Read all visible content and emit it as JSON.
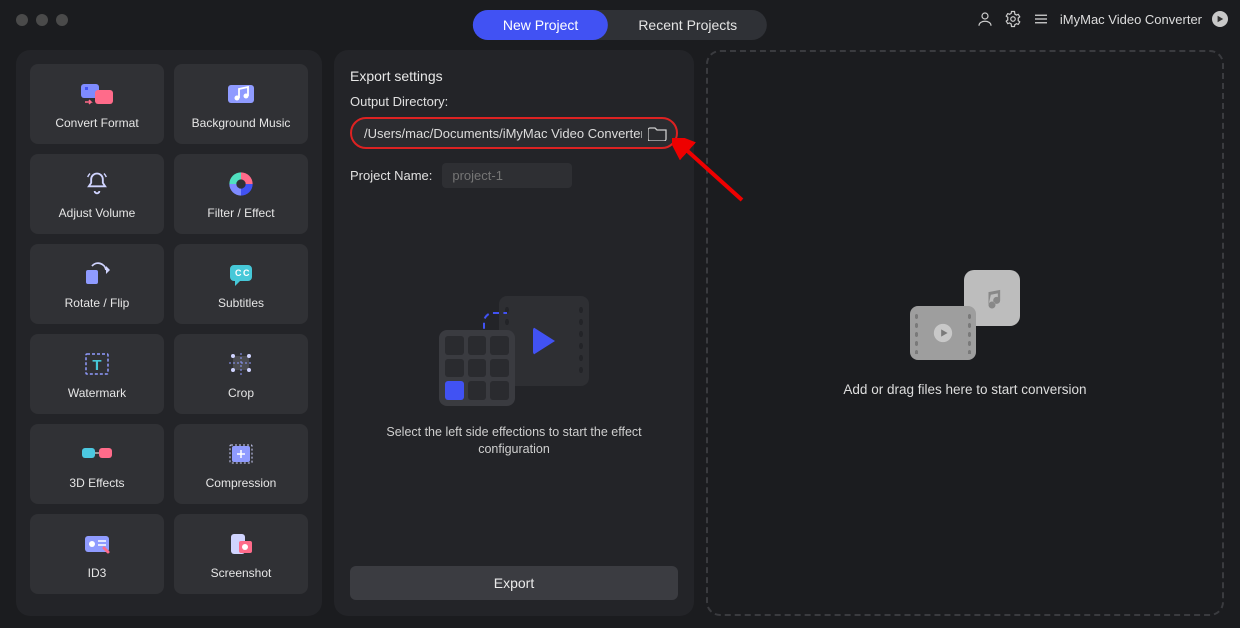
{
  "titlebar": {
    "tabs": {
      "new_project": "New Project",
      "recent_projects": "Recent Projects"
    },
    "brand": "iMyMac Video Converter"
  },
  "sidebar": {
    "tiles": [
      {
        "key": "convert-format",
        "label": "Convert Format",
        "icon": "convert-icon"
      },
      {
        "key": "background-music",
        "label": "Background Music",
        "icon": "music-note-icon"
      },
      {
        "key": "adjust-volume",
        "label": "Adjust Volume",
        "icon": "bell-icon"
      },
      {
        "key": "filter-effect",
        "label": "Filter / Effect",
        "icon": "aperture-icon"
      },
      {
        "key": "rotate-flip",
        "label": "Rotate / Flip",
        "icon": "rotate-icon"
      },
      {
        "key": "subtitles",
        "label": "Subtitles",
        "icon": "subtitle-icon"
      },
      {
        "key": "watermark",
        "label": "Watermark",
        "icon": "text-t-icon"
      },
      {
        "key": "crop",
        "label": "Crop",
        "icon": "crop-icon"
      },
      {
        "key": "3d-effects",
        "label": "3D Effects",
        "icon": "glasses-icon"
      },
      {
        "key": "compression",
        "label": "Compression",
        "icon": "compress-icon"
      },
      {
        "key": "id3",
        "label": "ID3",
        "icon": "id-tag-icon"
      },
      {
        "key": "screenshot",
        "label": "Screenshot",
        "icon": "screenshot-icon"
      }
    ]
  },
  "export_settings": {
    "title": "Export settings",
    "output_directory_label": "Output Directory:",
    "output_directory_value": "/Users/mac/Documents/iMyMac Video Converter",
    "project_name_label": "Project Name:",
    "project_name_placeholder": "project-1",
    "hint": "Select the left side effections to start the effect configuration",
    "export_button": "Export"
  },
  "dropzone": {
    "message": "Add or drag files here to start conversion"
  },
  "colors": {
    "accent": "#4152f3",
    "highlight": "#d22"
  }
}
